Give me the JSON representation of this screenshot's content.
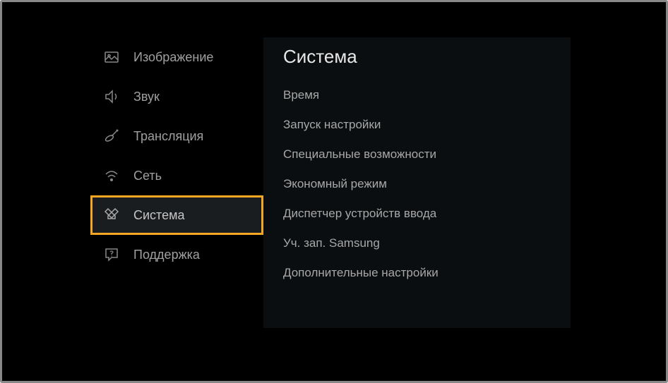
{
  "sidebar": {
    "items": [
      {
        "label": "Изображение"
      },
      {
        "label": "Звук"
      },
      {
        "label": "Трансляция"
      },
      {
        "label": "Сеть"
      },
      {
        "label": "Система"
      },
      {
        "label": "Поддержка"
      }
    ]
  },
  "content": {
    "title": "Система",
    "items": [
      {
        "label": "Время"
      },
      {
        "label": "Запуск настройки"
      },
      {
        "label": "Специальные возможности"
      },
      {
        "label": "Экономный режим"
      },
      {
        "label": "Диспетчер устройств ввода"
      },
      {
        "label": "Уч. зап. Samsung"
      },
      {
        "label": "Дополнительные настройки"
      }
    ]
  }
}
